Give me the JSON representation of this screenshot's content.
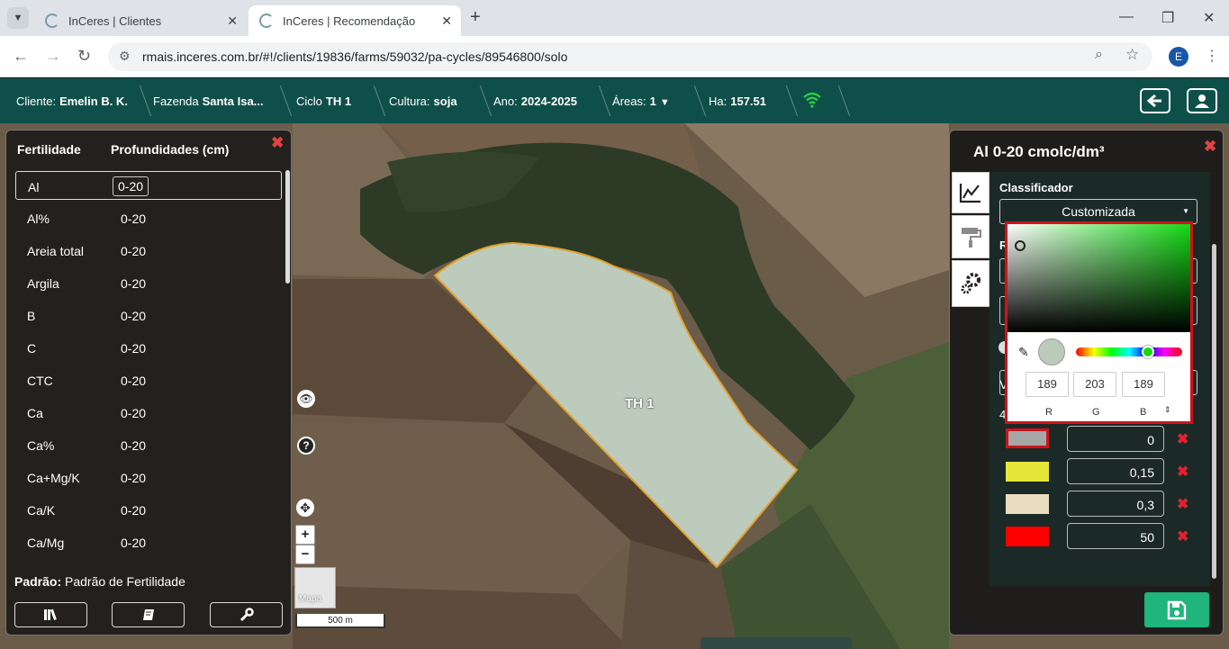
{
  "browser": {
    "tabs": [
      {
        "title": "InCeres | Clientes",
        "active": false
      },
      {
        "title": "InCeres | Recomendação",
        "active": true
      }
    ],
    "new_tab": "+",
    "url": "rmais.inceres.com.br/#!/clients/19836/farms/59032/pa-cycles/89546800/solo",
    "profile_initial": "E"
  },
  "header": {
    "items": [
      {
        "label": "Cliente:",
        "value": "Emelin B. K."
      },
      {
        "label": "Fazenda",
        "value": "Santa Isa..."
      },
      {
        "label": "Ciclo",
        "value": "TH 1"
      },
      {
        "label": "Cultura:",
        "value": "soja"
      },
      {
        "label": "Ano:",
        "value": "2024-2025"
      },
      {
        "label": "Áreas:",
        "value": "1"
      },
      {
        "label": "Ha:",
        "value": "157.51"
      }
    ]
  },
  "left_panel": {
    "col1": "Fertilidade",
    "col2": "Profundidades (cm)",
    "rows": [
      {
        "name": "Al",
        "depth": "0-20",
        "selected": true
      },
      {
        "name": "Al%",
        "depth": "0-20"
      },
      {
        "name": "Areia total",
        "depth": "0-20"
      },
      {
        "name": "Argila",
        "depth": "0-20"
      },
      {
        "name": "B",
        "depth": "0-20"
      },
      {
        "name": "C",
        "depth": "0-20"
      },
      {
        "name": "CTC",
        "depth": "0-20"
      },
      {
        "name": "Ca",
        "depth": "0-20"
      },
      {
        "name": "Ca%",
        "depth": "0-20"
      },
      {
        "name": "Ca+Mg/K",
        "depth": "0-20"
      },
      {
        "name": "Ca/K",
        "depth": "0-20"
      },
      {
        "name": "Ca/Mg",
        "depth": "0-20"
      }
    ],
    "pattern_label": "Padrão:",
    "pattern_value": "Padrão de Fertilidade"
  },
  "map": {
    "field_label": "TH 1",
    "scale_label": "500 m",
    "basemap_label": "Mapa",
    "field_color": "#bdcbbd",
    "field_border": "#e2a12a"
  },
  "right_panel": {
    "title": "Al 0-20 cmolc/dm³",
    "classifier_label": "Classificador",
    "classifier_value": "Customizada",
    "partial_r": "R",
    "partial_v": "V",
    "partial_4": "4",
    "classes": [
      {
        "color": "#a7a7a7",
        "value": "0",
        "selected": true
      },
      {
        "color": "#e6e63a",
        "value": "0,15"
      },
      {
        "color": "#e9dcc0",
        "value": "0,3"
      },
      {
        "color": "#ff0000",
        "value": "50"
      }
    ]
  },
  "color_picker": {
    "r": "189",
    "g": "203",
    "b": "189",
    "r_label": "R",
    "g_label": "G",
    "b_label": "B",
    "current": "#bdcbbd",
    "hue": "#14d914"
  }
}
